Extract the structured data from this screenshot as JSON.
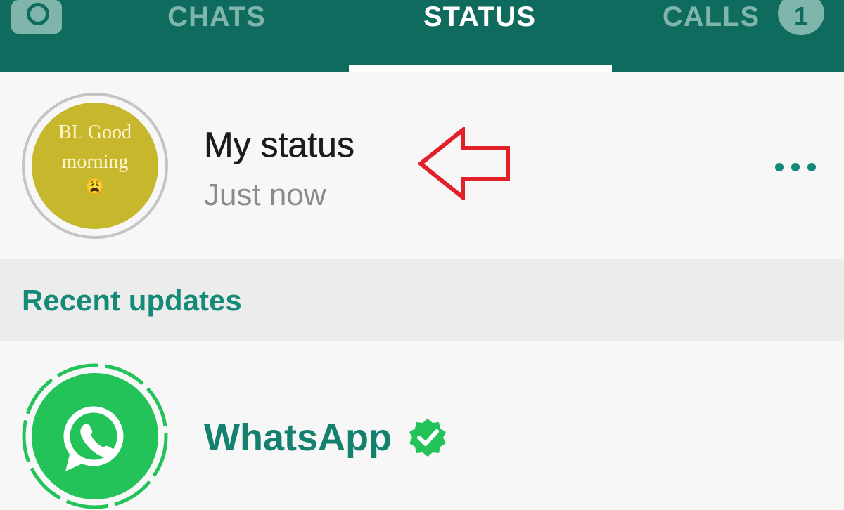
{
  "tabs": [
    {
      "label": "CHATS"
    },
    {
      "label": "STATUS",
      "active": true
    },
    {
      "label": "CALLS",
      "badge": "1"
    }
  ],
  "my_status": {
    "title": "My status",
    "time": "Just now",
    "thumbnail_line1": "BL Good",
    "thumbnail_line2": "morning",
    "thumbnail_emoji": "😩"
  },
  "section": {
    "recent_label": "Recent updates"
  },
  "updates": [
    {
      "name": "WhatsApp",
      "verified": true
    }
  ],
  "icons": {
    "camera": "camera-icon",
    "more": "more-horizontal-icon",
    "arrow": "arrow-left-outline-icon",
    "verified": "verified-check-icon",
    "whatsapp": "whatsapp-logo-icon"
  },
  "colors": {
    "header": "#0f6b5d",
    "tab_inactive": "#7fb5ab",
    "accent": "#158a78",
    "whatsapp_green": "#23c35a",
    "annotation_arrow": "#e3202a"
  }
}
